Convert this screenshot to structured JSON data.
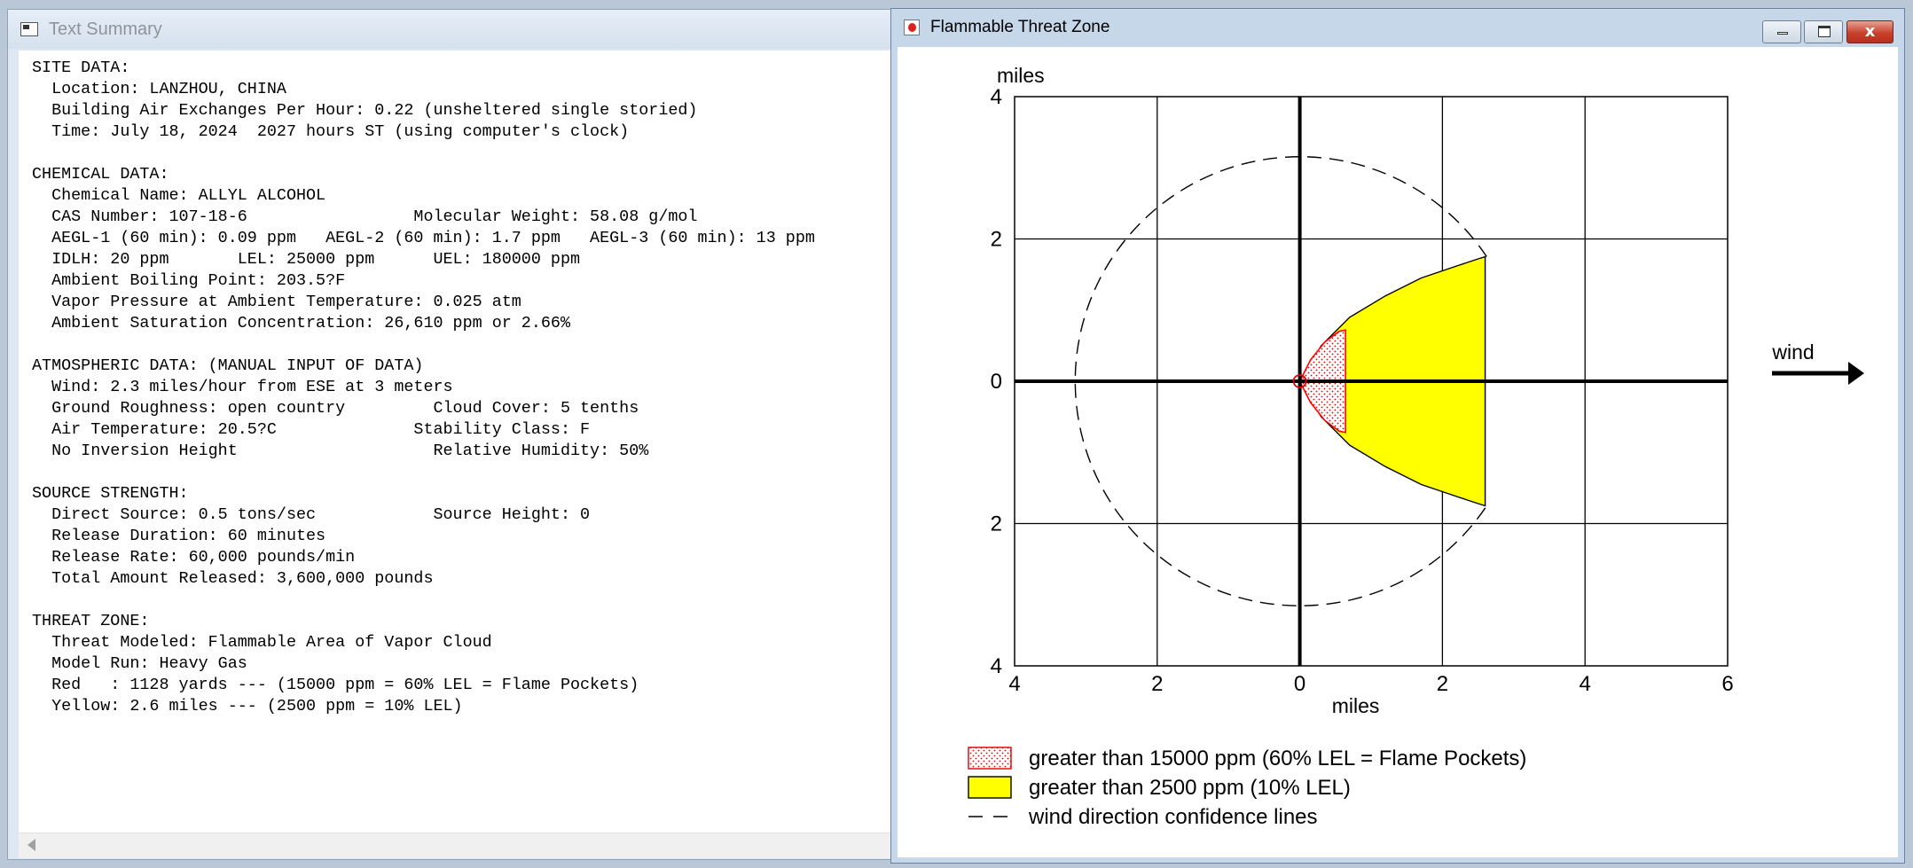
{
  "text_window": {
    "title": "Text Summary",
    "lines": [
      "SITE DATA:",
      "  Location: LANZHOU, CHINA",
      "  Building Air Exchanges Per Hour: 0.22 (unsheltered single storied)",
      "  Time: July 18, 2024  2027 hours ST (using computer's clock)",
      "",
      "CHEMICAL DATA:",
      "  Chemical Name: ALLYL ALCOHOL",
      "  CAS Number: 107-18-6                 Molecular Weight: 58.08 g/mol",
      "  AEGL-1 (60 min): 0.09 ppm   AEGL-2 (60 min): 1.7 ppm   AEGL-3 (60 min): 13 ppm",
      "  IDLH: 20 ppm       LEL: 25000 ppm      UEL: 180000 ppm",
      "  Ambient Boiling Point: 203.5?F",
      "  Vapor Pressure at Ambient Temperature: 0.025 atm",
      "  Ambient Saturation Concentration: 26,610 ppm or 2.66%",
      "",
      "ATMOSPHERIC DATA: (MANUAL INPUT OF DATA)",
      "  Wind: 2.3 miles/hour from ESE at 3 meters",
      "  Ground Roughness: open country         Cloud Cover: 5 tenths",
      "  Air Temperature: 20.5?C              Stability Class: F",
      "  No Inversion Height                    Relative Humidity: 50%",
      "",
      "SOURCE STRENGTH:",
      "  Direct Source: 0.5 tons/sec            Source Height: 0",
      "  Release Duration: 60 minutes",
      "  Release Rate: 60,000 pounds/min",
      "  Total Amount Released: 3,600,000 pounds",
      "",
      "THREAT ZONE:",
      "  Threat Modeled: Flammable Area of Vapor Cloud",
      "  Model Run: Heavy Gas",
      "  Red   : 1128 yards --- (15000 ppm = 60% LEL = Flame Pockets)",
      "  Yellow: 2.6 miles --- (2500 ppm = 10% LEL)"
    ]
  },
  "plot_window": {
    "title": "Flammable Threat Zone",
    "close_glyph": "x"
  },
  "chart_data": {
    "type": "area",
    "xlabel": "miles",
    "ylabel": "miles",
    "xlim": [
      -4,
      6
    ],
    "ylim": [
      -4,
      4
    ],
    "x_tick_labels": [
      "4",
      "2",
      "0",
      "2",
      "4",
      "6"
    ],
    "y_tick_labels": [
      "4",
      "2",
      "0",
      "2",
      "4"
    ],
    "grid": true,
    "wind_label": "wind",
    "wind_direction": "right",
    "series": [
      {
        "name": "greater than 2500 ppm (10% LEL)",
        "color": "#ffff00",
        "edge_color": "#000000",
        "x": [
          0,
          0.3,
          0.7,
          1.2,
          1.7,
          2.2,
          2.5,
          2.6,
          2.6,
          2.5,
          2.2,
          1.7,
          1.2,
          0.7,
          0.3,
          0
        ],
        "y": [
          0,
          0.5,
          0.9,
          1.2,
          1.45,
          1.62,
          1.72,
          1.75,
          -1.75,
          -1.72,
          -1.62,
          -1.45,
          -1.2,
          -0.9,
          -0.5,
          0
        ]
      },
      {
        "name": "greater than 15000 ppm (60% LEL = Flame Pockets)",
        "color": "#ff0000",
        "fill": "stippled",
        "x": [
          0,
          0.15,
          0.35,
          0.55,
          0.64,
          0.64,
          0.55,
          0.35,
          0.15,
          0
        ],
        "y": [
          0,
          0.3,
          0.55,
          0.7,
          0.72,
          -0.72,
          -0.7,
          -0.55,
          -0.3,
          0
        ]
      }
    ],
    "confidence_lines": {
      "name": "wind direction confidence lines",
      "center": [
        0,
        0
      ],
      "radius": 3.15,
      "line_end": [
        2.6,
        1.75
      ]
    },
    "legend": {
      "placement": "bottom-left",
      "entries": [
        "greater than 15000 ppm (60% LEL = Flame Pockets)",
        "greater than 2500 ppm (10% LEL)",
        "wind direction confidence lines"
      ]
    }
  }
}
